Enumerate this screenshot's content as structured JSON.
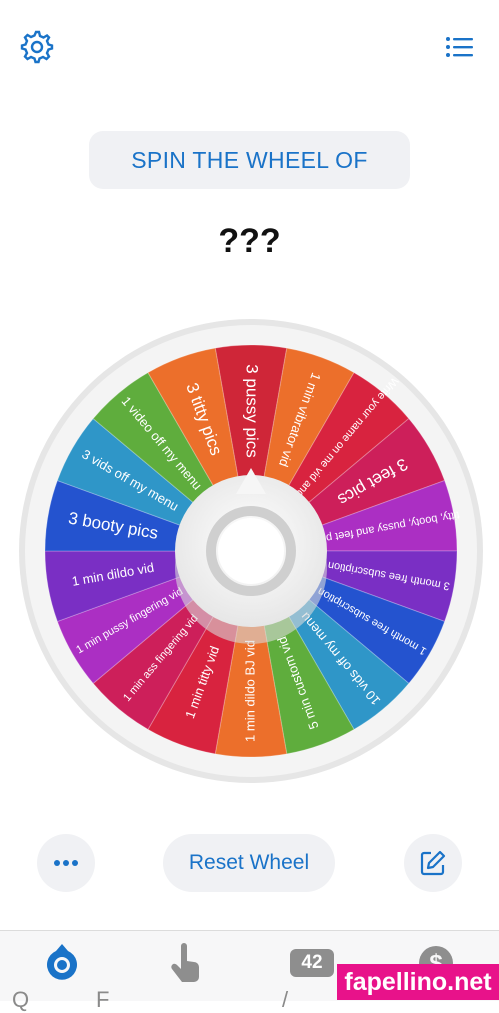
{
  "header": {
    "settings_icon": "gear-icon",
    "menu_icon": "list-icon",
    "title": "SPIN THE WHEEL OF",
    "result": "???"
  },
  "wheel": {
    "segments": [
      {
        "label": "3 pussy pics",
        "color": "#cf2638"
      },
      {
        "label": "1 min vibrator vid",
        "color": "#ec6f2b"
      },
      {
        "label": "Write your name on me vid and pic",
        "color": "#d8233f"
      },
      {
        "label": "3 feet pics",
        "color": "#cd1f5a"
      },
      {
        "label": "titty, booty, pussy and feet pic",
        "color": "#ab2fc3"
      },
      {
        "label": "3 month free subscription",
        "color": "#7a2fc4"
      },
      {
        "label": "1 month free subscription",
        "color": "#2453cf"
      },
      {
        "label": "10 vids off my menu",
        "color": "#2f96c8"
      },
      {
        "label": "5 min custom vid",
        "color": "#5fad3d"
      },
      {
        "label": "1 min dildo BJ vid",
        "color": "#ec6f2b"
      },
      {
        "label": "1 min titty vid",
        "color": "#d8233f"
      },
      {
        "label": "1 min ass fingering vid",
        "color": "#cd1f5a"
      },
      {
        "label": "1 min pussy fingering vid",
        "color": "#ab2fc3"
      },
      {
        "label": "1 min dildo vid",
        "color": "#7a2fc4"
      },
      {
        "label": "3 booty pics",
        "color": "#2453cf"
      },
      {
        "label": "3 vids off my menu",
        "color": "#2f96c8"
      },
      {
        "label": "1 video off my menu",
        "color": "#5fad3d"
      },
      {
        "label": "3 titty pics",
        "color": "#ec6f2b"
      }
    ]
  },
  "controls": {
    "more_icon": "ellipsis-icon",
    "reset_label": "Reset Wheel",
    "edit_icon": "edit-icon"
  },
  "tabbar": {
    "badge": "42",
    "tab_cut_labels": [
      "Q",
      "F",
      "/"
    ]
  },
  "watermark": "fapellino.net"
}
